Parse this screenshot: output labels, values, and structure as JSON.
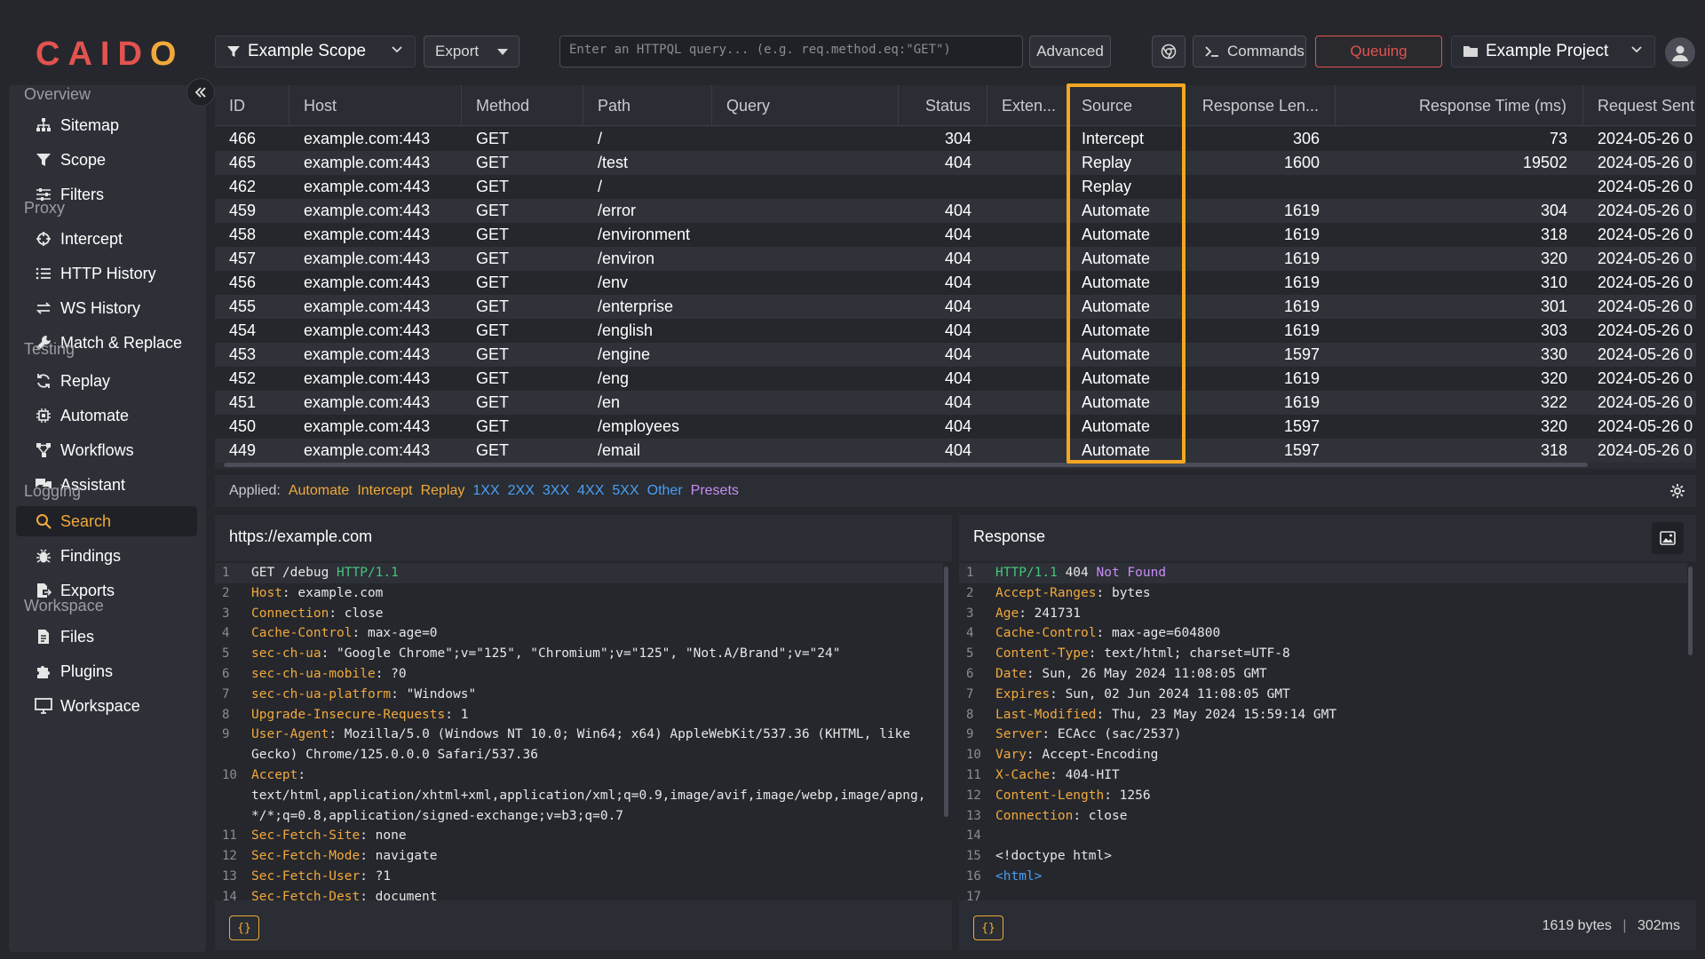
{
  "app": {
    "logo": "CAIDO"
  },
  "topbar": {
    "scope_label": "Example Scope",
    "export_label": "Export",
    "query_placeholder": "Enter an HTTPQL query... (e.g. req.method.eq:\"GET\")",
    "advanced_label": "Advanced",
    "commands_label": "Commands",
    "queuing_label": "Queuing",
    "project_label": "Example Project"
  },
  "sidebar": {
    "sections": [
      {
        "title": "Overview",
        "items": [
          {
            "label": "Sitemap",
            "icon": "sitemap-icon"
          },
          {
            "label": "Scope",
            "icon": "funnel-icon"
          },
          {
            "label": "Filters",
            "icon": "sliders-icon"
          }
        ]
      },
      {
        "title": "Proxy",
        "items": [
          {
            "label": "Intercept",
            "icon": "crosshair-icon"
          },
          {
            "label": "HTTP History",
            "icon": "list-icon"
          },
          {
            "label": "WS History",
            "icon": "arrows-icon"
          },
          {
            "label": "Match & Replace",
            "icon": "wrench-icon"
          }
        ]
      },
      {
        "title": "Testing",
        "items": [
          {
            "label": "Replay",
            "icon": "refresh-icon"
          },
          {
            "label": "Automate",
            "icon": "cpu-icon"
          },
          {
            "label": "Workflows",
            "icon": "workflow-icon"
          },
          {
            "label": "Assistant",
            "icon": "chat-icon"
          }
        ]
      },
      {
        "title": "Logging",
        "items": [
          {
            "label": "Search",
            "icon": "search-icon",
            "active": true
          },
          {
            "label": "Findings",
            "icon": "bug-icon"
          },
          {
            "label": "Exports",
            "icon": "export-file-icon"
          }
        ]
      },
      {
        "title": "Workspace",
        "items": [
          {
            "label": "Files",
            "icon": "file-icon"
          },
          {
            "label": "Plugins",
            "icon": "puzzle-icon"
          },
          {
            "label": "Workspace",
            "icon": "monitor-icon"
          }
        ]
      }
    ]
  },
  "table": {
    "columns": [
      "ID",
      "Host",
      "Method",
      "Path",
      "Query",
      "Status",
      "Exten...",
      "Source",
      "Response Len...",
      "Response Time (ms)",
      "Request Sent"
    ],
    "rows": [
      [
        "466",
        "example.com:443",
        "GET",
        "/",
        "",
        "304",
        "",
        "Intercept",
        "306",
        "73",
        "2024-05-26 0"
      ],
      [
        "465",
        "example.com:443",
        "GET",
        "/test",
        "",
        "404",
        "",
        "Replay",
        "1600",
        "19502",
        "2024-05-26 0"
      ],
      [
        "462",
        "example.com:443",
        "GET",
        "/",
        "",
        "",
        "",
        "Replay",
        "",
        "",
        "2024-05-26 0"
      ],
      [
        "459",
        "example.com:443",
        "GET",
        "/error",
        "",
        "404",
        "",
        "Automate",
        "1619",
        "304",
        "2024-05-26 0"
      ],
      [
        "458",
        "example.com:443",
        "GET",
        "/environment",
        "",
        "404",
        "",
        "Automate",
        "1619",
        "318",
        "2024-05-26 0"
      ],
      [
        "457",
        "example.com:443",
        "GET",
        "/environ",
        "",
        "404",
        "",
        "Automate",
        "1619",
        "320",
        "2024-05-26 0"
      ],
      [
        "456",
        "example.com:443",
        "GET",
        "/env",
        "",
        "404",
        "",
        "Automate",
        "1619",
        "310",
        "2024-05-26 0"
      ],
      [
        "455",
        "example.com:443",
        "GET",
        "/enterprise",
        "",
        "404",
        "",
        "Automate",
        "1619",
        "301",
        "2024-05-26 0"
      ],
      [
        "454",
        "example.com:443",
        "GET",
        "/english",
        "",
        "404",
        "",
        "Automate",
        "1619",
        "303",
        "2024-05-26 0"
      ],
      [
        "453",
        "example.com:443",
        "GET",
        "/engine",
        "",
        "404",
        "",
        "Automate",
        "1597",
        "330",
        "2024-05-26 0"
      ],
      [
        "452",
        "example.com:443",
        "GET",
        "/eng",
        "",
        "404",
        "",
        "Automate",
        "1619",
        "320",
        "2024-05-26 0"
      ],
      [
        "451",
        "example.com:443",
        "GET",
        "/en",
        "",
        "404",
        "",
        "Automate",
        "1619",
        "322",
        "2024-05-26 0"
      ],
      [
        "450",
        "example.com:443",
        "GET",
        "/employees",
        "",
        "404",
        "",
        "Automate",
        "1597",
        "320",
        "2024-05-26 0"
      ],
      [
        "449",
        "example.com:443",
        "GET",
        "/email",
        "",
        "404",
        "",
        "Automate",
        "1597",
        "318",
        "2024-05-26 0"
      ]
    ]
  },
  "filters": {
    "applied_label": "Applied:",
    "items": [
      {
        "label": "Automate",
        "color": "orange"
      },
      {
        "label": "Intercept",
        "color": "orange"
      },
      {
        "label": "Replay",
        "color": "orange"
      },
      {
        "label": "1XX",
        "color": "blue"
      },
      {
        "label": "2XX",
        "color": "blue"
      },
      {
        "label": "3XX",
        "color": "blue"
      },
      {
        "label": "4XX",
        "color": "blue"
      },
      {
        "label": "5XX",
        "color": "blue"
      },
      {
        "label": "Other",
        "color": "blue"
      },
      {
        "label": "Presets",
        "color": "purple"
      }
    ]
  },
  "request": {
    "title": "https://example.com",
    "lines": [
      {
        "n": "1",
        "parts": [
          [
            "",
            "GET /debug "
          ],
          [
            "ver",
            "HTTP/1.1"
          ]
        ]
      },
      {
        "n": "2",
        "parts": [
          [
            "hk",
            "Host"
          ],
          [
            "",
            ": example.com"
          ]
        ]
      },
      {
        "n": "3",
        "parts": [
          [
            "hk",
            "Connection"
          ],
          [
            "",
            ": close"
          ]
        ]
      },
      {
        "n": "4",
        "parts": [
          [
            "hk",
            "Cache-Control"
          ],
          [
            "",
            ": max-age=0"
          ]
        ]
      },
      {
        "n": "5",
        "parts": [
          [
            "hk",
            "sec-ch-ua"
          ],
          [
            "",
            ": \"Google Chrome\";v=\"125\", \"Chromium\";v=\"125\", \"Not.A/Brand\";v=\"24\""
          ]
        ]
      },
      {
        "n": "6",
        "parts": [
          [
            "hk",
            "sec-ch-ua-mobile"
          ],
          [
            "",
            ": ?0"
          ]
        ]
      },
      {
        "n": "7",
        "parts": [
          [
            "hk",
            "sec-ch-ua-platform"
          ],
          [
            "",
            ": \"Windows\""
          ]
        ]
      },
      {
        "n": "8",
        "parts": [
          [
            "hk",
            "Upgrade-Insecure-Requests"
          ],
          [
            "",
            ": 1"
          ]
        ]
      },
      {
        "n": "9",
        "parts": [
          [
            "hk",
            "User-Agent"
          ],
          [
            "",
            ": Mozilla/5.0 (Windows NT 10.0; Win64; x64) AppleWebKit/537.36 (KHTML, like"
          ]
        ]
      },
      {
        "n": "",
        "parts": [
          [
            "",
            "Gecko) Chrome/125.0.0.0 Safari/537.36"
          ]
        ]
      },
      {
        "n": "10",
        "parts": [
          [
            "hk",
            "Accept"
          ],
          [
            "",
            ":"
          ]
        ]
      },
      {
        "n": "",
        "parts": [
          [
            "",
            "text/html,application/xhtml+xml,application/xml;q=0.9,image/avif,image/webp,image/apng,"
          ]
        ]
      },
      {
        "n": "",
        "parts": [
          [
            "",
            "*/*;q=0.8,application/signed-exchange;v=b3;q=0.7"
          ]
        ]
      },
      {
        "n": "11",
        "parts": [
          [
            "hk",
            "Sec-Fetch-Site"
          ],
          [
            "",
            ": none"
          ]
        ]
      },
      {
        "n": "12",
        "parts": [
          [
            "hk",
            "Sec-Fetch-Mode"
          ],
          [
            "",
            ": navigate"
          ]
        ]
      },
      {
        "n": "13",
        "parts": [
          [
            "hk",
            "Sec-Fetch-User"
          ],
          [
            "",
            ": ?1"
          ]
        ]
      },
      {
        "n": "14",
        "parts": [
          [
            "hk",
            "Sec-Fetch-Dest"
          ],
          [
            "",
            ": document"
          ]
        ]
      }
    ],
    "format_label": "{}"
  },
  "response": {
    "title": "Response",
    "lines": [
      {
        "n": "1",
        "parts": [
          [
            "ver",
            "HTTP/1.1"
          ],
          [
            "",
            " 404 "
          ],
          [
            "st-nf",
            "Not Found"
          ]
        ]
      },
      {
        "n": "2",
        "parts": [
          [
            "hk",
            "Accept-Ranges"
          ],
          [
            "",
            ": bytes"
          ]
        ]
      },
      {
        "n": "3",
        "parts": [
          [
            "hk",
            "Age"
          ],
          [
            "",
            ": 241731"
          ]
        ]
      },
      {
        "n": "4",
        "parts": [
          [
            "hk",
            "Cache-Control"
          ],
          [
            "",
            ": max-age=604800"
          ]
        ]
      },
      {
        "n": "5",
        "parts": [
          [
            "hk",
            "Content-Type"
          ],
          [
            "",
            ": text/html; charset=UTF-8"
          ]
        ]
      },
      {
        "n": "6",
        "parts": [
          [
            "hk",
            "Date"
          ],
          [
            "",
            ": Sun, 26 May 2024 11:08:05 GMT"
          ]
        ]
      },
      {
        "n": "7",
        "parts": [
          [
            "hk",
            "Expires"
          ],
          [
            "",
            ": Sun, 02 Jun 2024 11:08:05 GMT"
          ]
        ]
      },
      {
        "n": "8",
        "parts": [
          [
            "hk",
            "Last-Modified"
          ],
          [
            "",
            ": Thu, 23 May 2024 15:59:14 GMT"
          ]
        ]
      },
      {
        "n": "9",
        "parts": [
          [
            "hk",
            "Server"
          ],
          [
            "",
            ": ECAcc (sac/2537)"
          ]
        ]
      },
      {
        "n": "10",
        "parts": [
          [
            "hk",
            "Vary"
          ],
          [
            "",
            ": Accept-Encoding"
          ]
        ]
      },
      {
        "n": "11",
        "parts": [
          [
            "hk",
            "X-Cache"
          ],
          [
            "",
            ": 404-HIT"
          ]
        ]
      },
      {
        "n": "12",
        "parts": [
          [
            "hk",
            "Content-Length"
          ],
          [
            "",
            ": 1256"
          ]
        ]
      },
      {
        "n": "13",
        "parts": [
          [
            "hk",
            "Connection"
          ],
          [
            "",
            ": close"
          ]
        ]
      },
      {
        "n": "14",
        "parts": [
          [
            "",
            ""
          ]
        ]
      },
      {
        "n": "15",
        "parts": [
          [
            "",
            "<!doctype html>"
          ]
        ]
      },
      {
        "n": "16",
        "parts": [
          [
            "tag",
            "<html>"
          ]
        ]
      },
      {
        "n": "17",
        "parts": [
          [
            "",
            ""
          ]
        ]
      }
    ],
    "format_label": "{}",
    "size_label": "1619 bytes",
    "time_label": "302ms"
  },
  "colors": {
    "accent_orange": "#f2a93b",
    "accent_red": "#e2534f",
    "filter_blue": "#4a9ff5",
    "filter_purple": "#c98df5",
    "http_version_green": "#46c47b",
    "highlight_border": "#f5a623"
  }
}
